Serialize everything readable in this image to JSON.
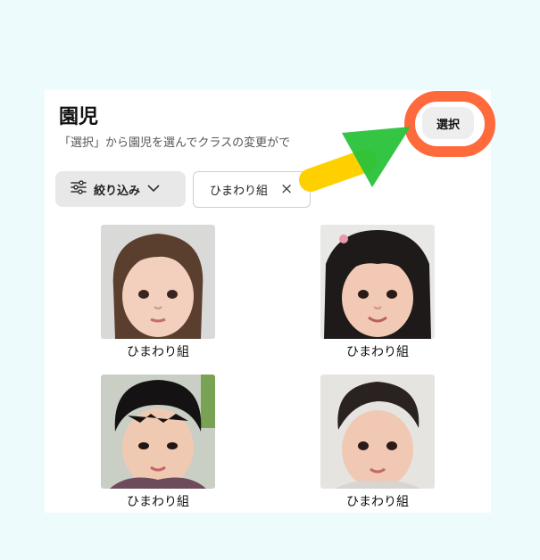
{
  "header": {
    "title": "園児",
    "subtitle": "「選択」から園児を選んでクラスの変更がで",
    "select_label": "選択"
  },
  "filters": {
    "filter_label": "絞り込み",
    "active_chip": "ひまわり組",
    "chip_close": "×"
  },
  "children": [
    {
      "class_name": "ひまわり組"
    },
    {
      "class_name": "ひまわり組"
    },
    {
      "class_name": "ひまわり組"
    },
    {
      "class_name": "ひまわり組"
    }
  ],
  "icons": {
    "filter": "sliders-icon",
    "dropdown": "chevron-down-icon",
    "close": "close-icon"
  },
  "colors": {
    "page_background": "#eefbfd",
    "highlight_ring": "#ff6a3d",
    "arrow_head": "#29c23a",
    "arrow_tail": "#ffd000"
  }
}
